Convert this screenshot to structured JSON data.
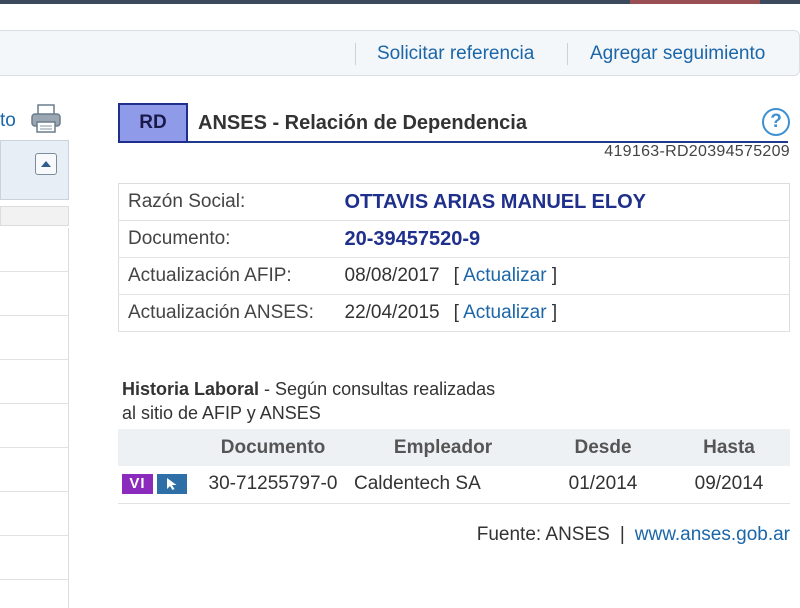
{
  "toolbar": {
    "request_reference": "Solicitar referencia",
    "add_tracking": "Agregar seguimiento"
  },
  "left_panel": {
    "partial_label": "to"
  },
  "header": {
    "badge": "RD",
    "title": "ANSES - Relación de Dependencia",
    "code": "419163-RD20394575209",
    "help_glyph": "?"
  },
  "info": {
    "razon_social_label": "Razón Social:",
    "razon_social_value": "OTTAVIS ARIAS MANUEL ELOY",
    "documento_label": "Documento:",
    "documento_value": "20-39457520-9",
    "afip_label": "Actualización AFIP:",
    "afip_date": "08/08/2017",
    "anses_label": "Actualización ANSES:",
    "anses_date": "22/04/2015",
    "bracket_open": "[",
    "bracket_close": "]",
    "update_link": "Actualizar"
  },
  "history": {
    "title_bold": "Historia Laboral",
    "title_rest_1": " - Según consultas realizadas",
    "title_rest_2": "al sitio de AFIP y ANSES",
    "columns": [
      "Documento",
      "Empleador",
      "Desde",
      "Hasta"
    ],
    "rows": [
      {
        "badge": "VI",
        "documento": "30-71255797-0",
        "empleador": "Caldentech SA",
        "desde": "01/2014",
        "hasta": "09/2014"
      }
    ]
  },
  "source": {
    "label": "Fuente: ANSES",
    "separator": "|",
    "link": "www.anses.gob.ar"
  },
  "colors": {
    "brand_blue": "#1f2f8c",
    "link_blue": "#1a66a8",
    "badge_purple": "#8a2bbd",
    "rd_badge_bg": "#8f9ae8"
  }
}
